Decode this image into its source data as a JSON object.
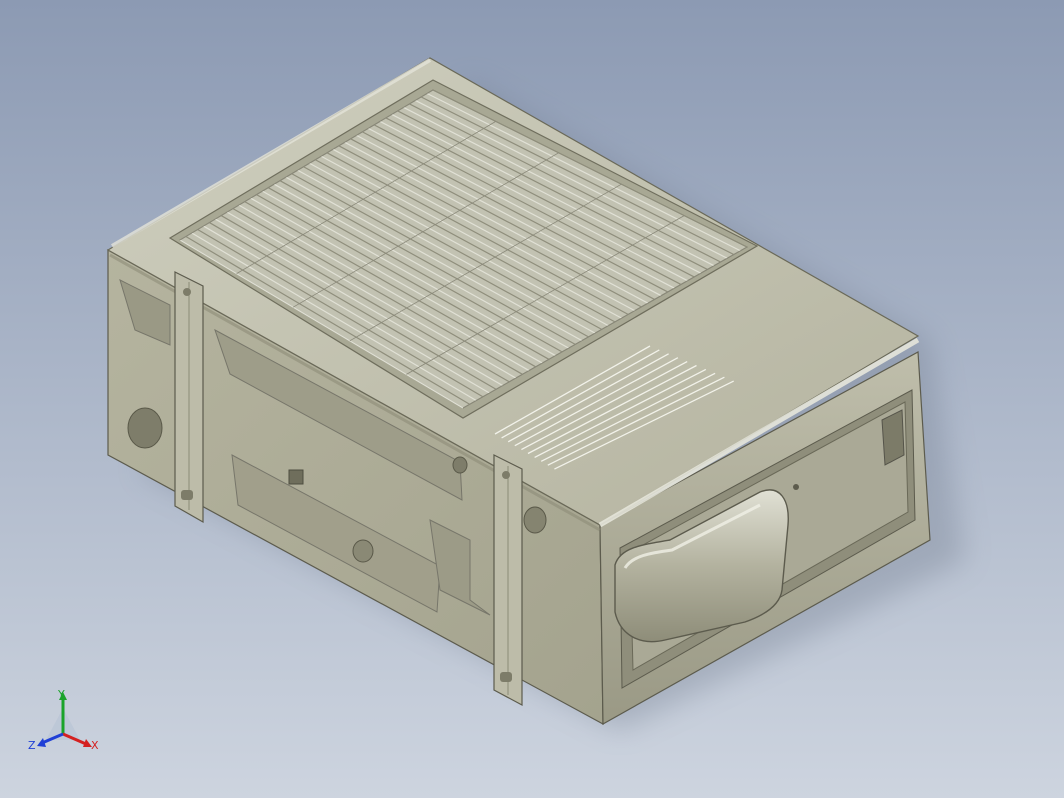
{
  "viewport": {
    "background_top": "#8c9ab3",
    "background_bottom": "#cdd4df"
  },
  "model": {
    "body_color": "#b3b29e",
    "shade_color": "#8d8b78",
    "highlight_color": "#dcdccf",
    "edge_color": "#5c5b4d"
  },
  "triad": {
    "x_label": "X",
    "y_label": "Y",
    "z_label": "Z",
    "x_color": "#d42020",
    "y_color": "#1aa32a",
    "z_color": "#1f3fd6"
  }
}
